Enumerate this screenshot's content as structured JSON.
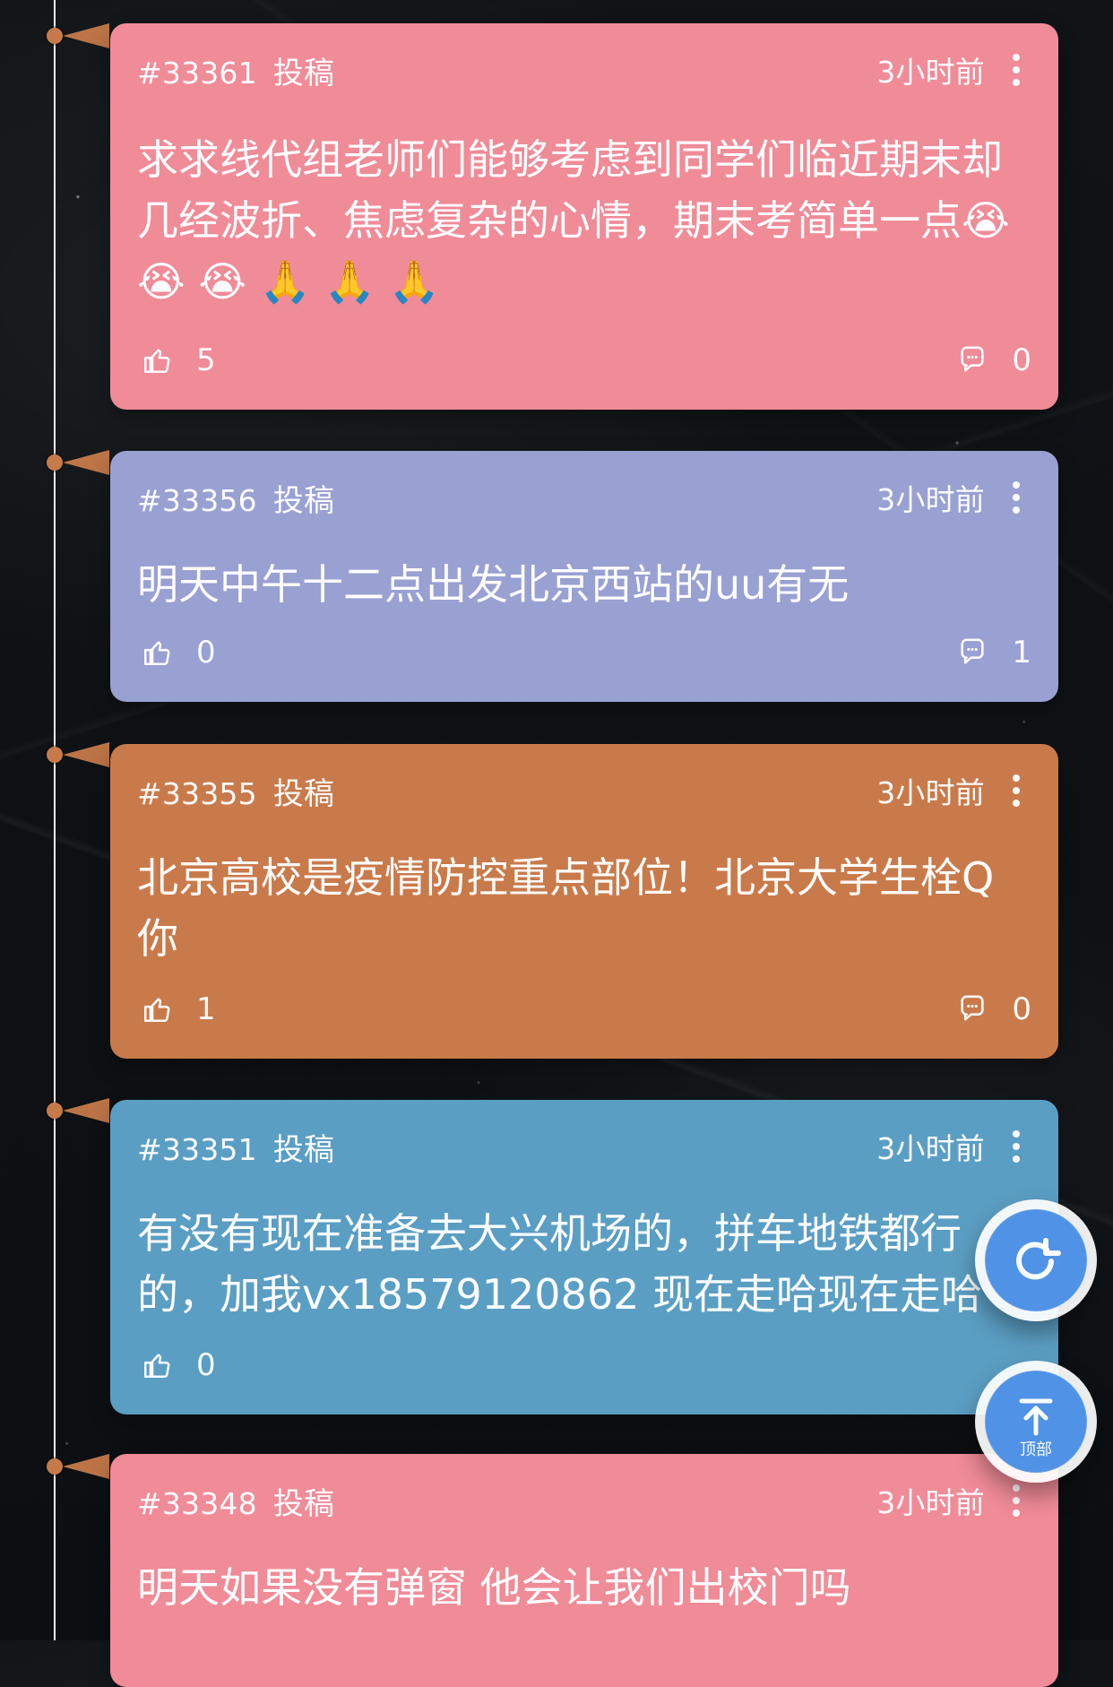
{
  "colors": {
    "timeline_accent": "#c67a4a",
    "card_pink": "#f08b98",
    "card_purple": "#99a0d2",
    "card_orange": "#c97a4b",
    "card_blue": "#5b9ec3",
    "fab_blue": "#4f92e6"
  },
  "posts": [
    {
      "id": "#33361",
      "type": "投稿",
      "time": "3小时前",
      "text": "求求线代组老师们能够考虑到同学们临近期末却几经波折、焦虑复杂的心情，期末考简单一点😭 😭 😭 🙏 🙏 🙏",
      "likes": "5",
      "comments": "0"
    },
    {
      "id": "#33356",
      "type": "投稿",
      "time": "3小时前",
      "text": "明天中午十二点出发北京西站的uu有无",
      "likes": "0",
      "comments": "1"
    },
    {
      "id": "#33355",
      "type": "投稿",
      "time": "3小时前",
      "text": "北京高校是疫情防控重点部位！北京大学生栓Q你",
      "likes": "1",
      "comments": "0"
    },
    {
      "id": "#33351",
      "type": "投稿",
      "time": "3小时前",
      "text": "有没有现在准备去大兴机场的，拼车地铁都行的，加我vx18579120862 现在走哈现在走哈",
      "likes": "0",
      "comments": "0"
    },
    {
      "id": "#33348",
      "type": "投稿",
      "time": "3小时前",
      "text": "明天如果没有弹窗  他会让我们出校门吗"
    }
  ],
  "fabs": {
    "top_label": "顶部"
  },
  "icons": {
    "like": "thumbs-up-icon",
    "comment": "chat-bubble-icon",
    "more": "more-vertical-icon",
    "refresh": "refresh-icon",
    "to_top": "arrow-up-to-top-icon"
  }
}
